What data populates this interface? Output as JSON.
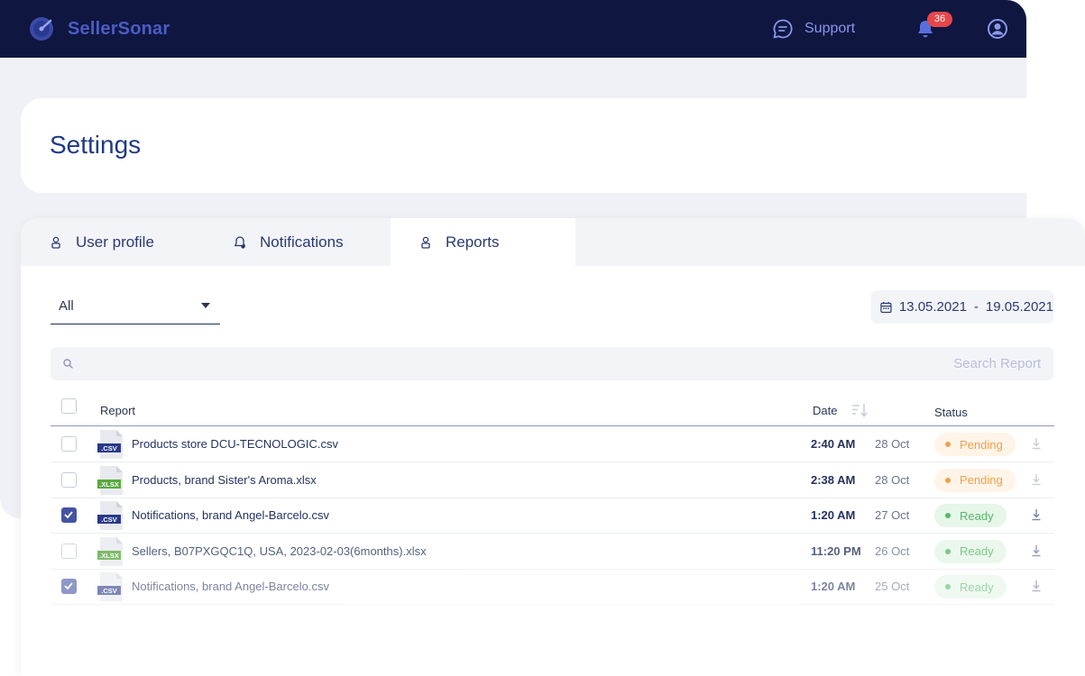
{
  "app": {
    "name": "SellerSonar"
  },
  "header": {
    "support_label": "Support",
    "notifications_count": "36"
  },
  "page": {
    "title": "Settings"
  },
  "tabs": [
    {
      "label": "User profile",
      "icon": "user-icon",
      "active": false
    },
    {
      "label": "Notifications",
      "icon": "bell-settings-icon",
      "active": false
    },
    {
      "label": "Reports",
      "icon": "user-icon",
      "active": true
    }
  ],
  "filters": {
    "type_select_value": "All",
    "date_from": "13.05.2021",
    "date_separator": "-",
    "date_to": "19.05.2021"
  },
  "search": {
    "placeholder": "Search Report",
    "value": ""
  },
  "table": {
    "columns": {
      "report": "Report",
      "date": "Date",
      "status": "Status"
    },
    "rows": [
      {
        "file_type": ".CSV",
        "name": "Products store DCU-TECNOLOGIC.csv",
        "time": "2:40 AM",
        "date": "28 Oct",
        "status": "Pending",
        "checked": false
      },
      {
        "file_type": ".XLSX",
        "name": "Products, brand Sister's Aroma.xlsx",
        "time": "2:38 AM",
        "date": "28 Oct",
        "status": "Pending",
        "checked": false
      },
      {
        "file_type": ".CSV",
        "name": "Notifications, brand Angel-Barcelo.csv",
        "time": "1:20 AM",
        "date": "27 Oct",
        "status": "Ready",
        "checked": true
      },
      {
        "file_type": ".XLSX",
        "name": "Sellers, B07PXGQC1Q, USA, 2023-02-03(6months).xlsx",
        "time": "11:20 PM",
        "date": "26 Oct",
        "status": "Ready",
        "checked": false
      },
      {
        "file_type": ".CSV",
        "name": "Notifications, brand Angel-Barcelo.csv",
        "time": "1:20 AM",
        "date": "25 Oct",
        "status": "Ready",
        "checked": true
      }
    ]
  },
  "colors": {
    "topbar": "#0f1640",
    "accent": "#4453a3",
    "csv_label": "#2a3a8a",
    "xlsx_label": "#5aa83f",
    "pending": "#f0a04a",
    "ready": "#58b86a"
  }
}
